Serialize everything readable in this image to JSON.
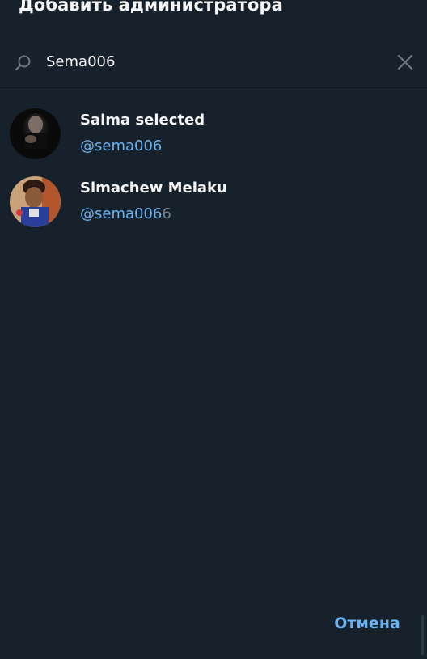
{
  "dialog": {
    "title": "Добавить администратора",
    "cancel_label": "Отмена"
  },
  "search": {
    "value": "Sema006",
    "placeholder": "",
    "icon": "search-icon",
    "clear_icon": "close-icon"
  },
  "results": [
    {
      "name": "Salma selected",
      "handle_match": "@sema006",
      "handle_rest": ""
    },
    {
      "name": "Simachew Melaku",
      "handle_match": "@sema006",
      "handle_rest": "6"
    }
  ],
  "colors": {
    "background": "#17212b",
    "accent": "#6ab2f2",
    "text": "#f5f5f5",
    "secondary_text": "#708499"
  }
}
